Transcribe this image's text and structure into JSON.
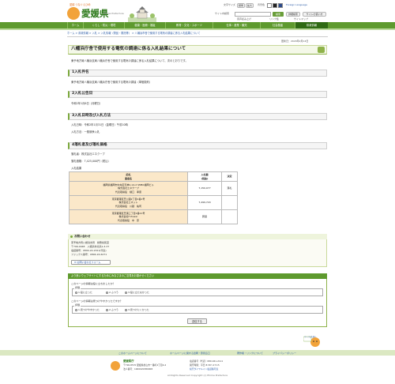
{
  "header": {
    "logo_tagline": "愛顔 つなぐえひめ",
    "logo_name": "愛媛県",
    "logo_sub": "Ehime Prefecture",
    "font_size_label": "文字サイズ",
    "font_size_small": "標準",
    "font_size_large": "拡大",
    "bg_color_label": "背景色",
    "language_link": "Foreign Language",
    "site_search_label": "サイト内検索",
    "search_placeholder": "",
    "search_button": "検索",
    "detail_search": "詳細検索",
    "site_usage": "サイトの使い方",
    "ehime_links": "ふるさと",
    "voice_reader": "音声読み上げ",
    "link_list": "リンク集",
    "sitemap": "サイトマップ"
  },
  "gnav": {
    "items": [
      {
        "label": "ホーム"
      },
      {
        "label": "くらし・防災・環境"
      },
      {
        "label": "健康・医療・福祉"
      },
      {
        "label": "教育・文化・スポーツ"
      },
      {
        "label": "仕事・産業・観光"
      },
      {
        "label": "社会基盤"
      },
      {
        "label": "県政情報"
      }
    ]
  },
  "breadcrumb": "ホーム > 県政情報 > 入札 > 入札情報（物品・委託等） > 八幡浜市舎で使用する電気の調達に係る入札結果について",
  "updated": "更新日：2020年2月14日",
  "page_title": "八幡浜庁舎で使用する電気の調達に係る入札結果について",
  "intro": "東予地方局八幡浜支局八幡浜庁舎で使用する電気の調達に係る入札結果について、次のとおりです。",
  "sections": {
    "s1": {
      "title": "1入札件名",
      "body": "東予地方局八幡浜支局八幡浜庁舎で使用する電気の調達（単価契約）"
    },
    "s2": {
      "title": "2入札公告日",
      "body": "令和2年1月6日（月曜日）"
    },
    "s3": {
      "title": "3入札日時及び入札方法",
      "body1": "入札日時：令和2年1月31日（金曜日）午前10時",
      "body2": "入札方法：一般競争入札"
    },
    "s4": {
      "title": "4落札者及び落札価格",
      "winner": "落札者：株式会社エネクープ",
      "price": "落札価格：7,425,000円（税込）",
      "table_caption": "入札結果"
    }
  },
  "results_table": {
    "headers": [
      "応札\n業者名",
      "入札額\n(税抜)",
      "決定"
    ],
    "rows": [
      {
        "lines": [
          "福岡県福岡市中央区天神1-14-2 SMBC福岡ビル",
          "株式会社エネクープ",
          "代表取締役　樋口　孝康"
        ],
        "amount": "7,150,077",
        "result": "落札"
      },
      {
        "lines": [
          "東京都港区芝公園2丁目4番1号",
          "株式会社エネット",
          "代表取締役　川越　祐司"
        ],
        "amount": "7,499,720",
        "result": ""
      },
      {
        "lines": [
          "東京都港区芝浦三丁目1番21号",
          "株式会社F-Power",
          "代表取締役　中　原"
        ],
        "amount": "辞退",
        "result": ""
      }
    ]
  },
  "contact": {
    "heading": "お問い合わせ",
    "line1": "東予地方局八幡浜支局　総務県民室",
    "line2": "〒796-0048　八幡浜市北浜1-3-37",
    "line3": "電話番号：0894-22-2321(代表)",
    "line4": "ファックス番号：0894-24-6271",
    "mail_button": "お問い合わせフォーム"
  },
  "survey": {
    "heading": "より良いウェブサイトにするためにみなさまのご意見をお聞かせください",
    "q1": "このページの情報は役に立ちましたか？",
    "q1_legend": "評価",
    "q1_options": [
      "1.役に立った",
      "2.ふつう",
      "3.役に立たなかった"
    ],
    "q2": "このページの情報は見つけやすかったですか？",
    "q2_legend": "評価",
    "q2_options": [
      "1.見つけやすかった",
      "2.ふつう",
      "3.見つけにくかった"
    ],
    "submit": "送信する"
  },
  "to_top": "ページの先頭へ",
  "footer": {
    "links": [
      "このホームページについて",
      "ホームページに関する質問・意見窓口",
      "著作権・リンクについて",
      "プライバシーポリシー"
    ],
    "office_name": "愛媛県庁",
    "address_line1": "〒790-8570 愛媛県松山市一番町4丁目4-2",
    "address_line2": "法人番号：1000020380008",
    "phone": "電話番号（代表）089-941-2111",
    "hours": "開庁時間：平日 8:30～17:15",
    "directions": "県庁ダイヤルイン電話番号表",
    "copyright": "All Rights Reserved Copyright (c) Ehime Prefecture"
  }
}
